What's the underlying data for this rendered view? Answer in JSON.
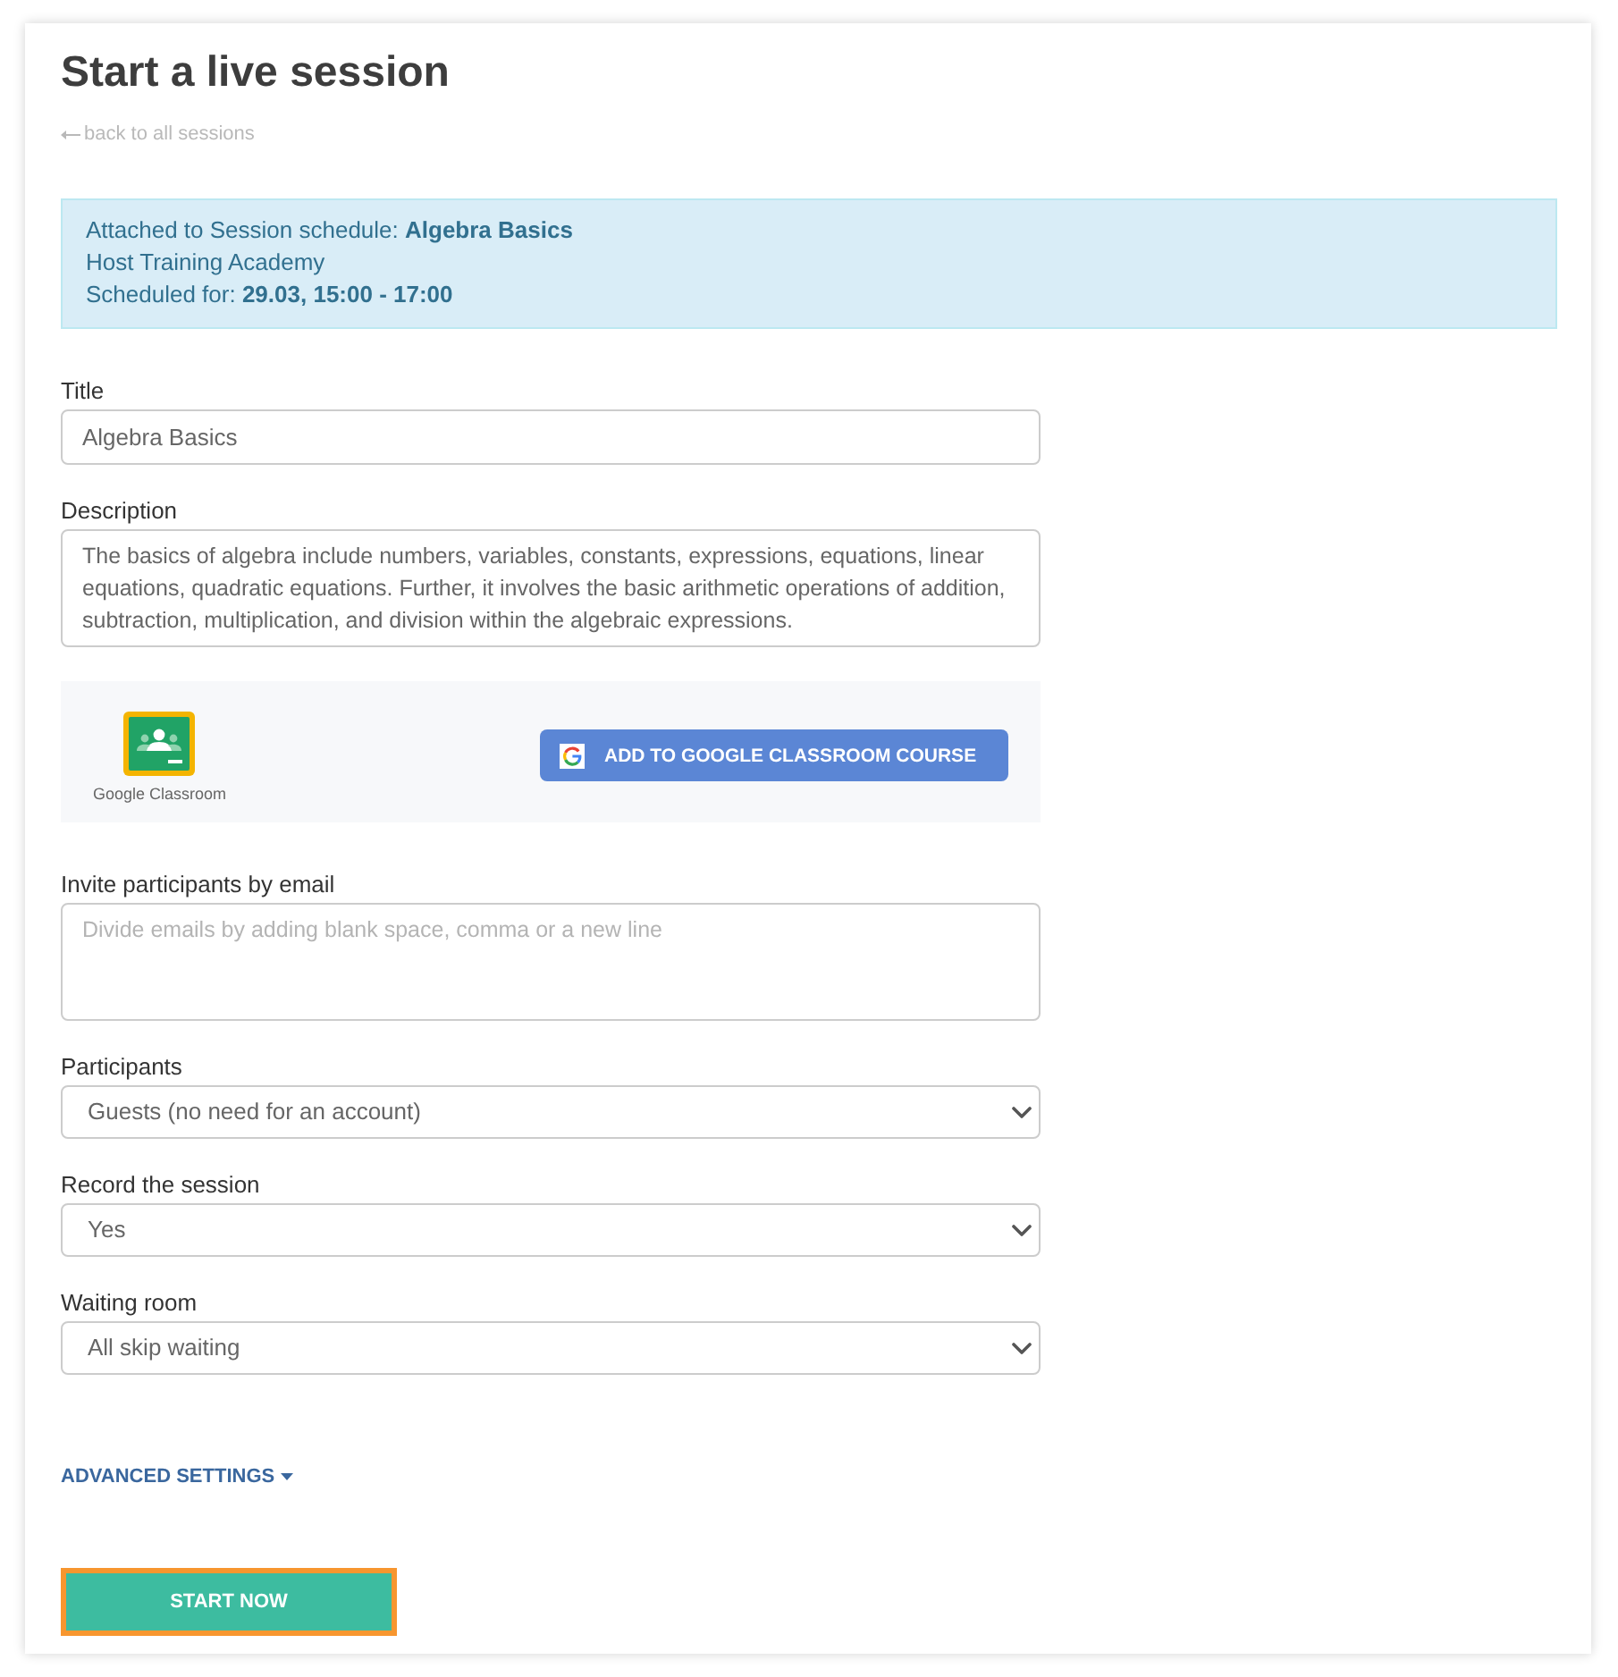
{
  "page": {
    "title": "Start a live session",
    "back_link": "back to all sessions"
  },
  "schedule_info": {
    "lines": [
      "Attached to Session schedule: **Algebra Basics**",
      "Host Training Academy",
      "Scheduled for: **29.03, 15:00 - 17:00**"
    ]
  },
  "title_field": {
    "label": "Title",
    "value": "Algebra Basics"
  },
  "description_field": {
    "label": "Description",
    "value": "The basics of algebra include numbers, variables, constants, expressions, equations, linear equations, quadratic equations. Further, it involves the basic arithmetic operations of addition, subtraction, multiplication, and division within the algebraic expressions."
  },
  "google_classroom": {
    "logo_caption": "Google Classroom",
    "button": "ADD TO GOOGLE CLASSROOM COURSE"
  },
  "invite_field": {
    "label": "Invite participants by email",
    "placeholder": "Divide emails by adding blank space, comma or a new line"
  },
  "selects": [
    {
      "label": "Participants",
      "value": "Guests (no need for an account)"
    },
    {
      "label": "Record the session",
      "value": "Yes"
    },
    {
      "label": "Waiting room",
      "value": "All skip waiting"
    }
  ],
  "advanced_settings": {
    "label": "ADVANCED SETTINGS",
    "expanded": false
  },
  "start_button": {
    "label": "START NOW",
    "highlighted": true
  }
}
